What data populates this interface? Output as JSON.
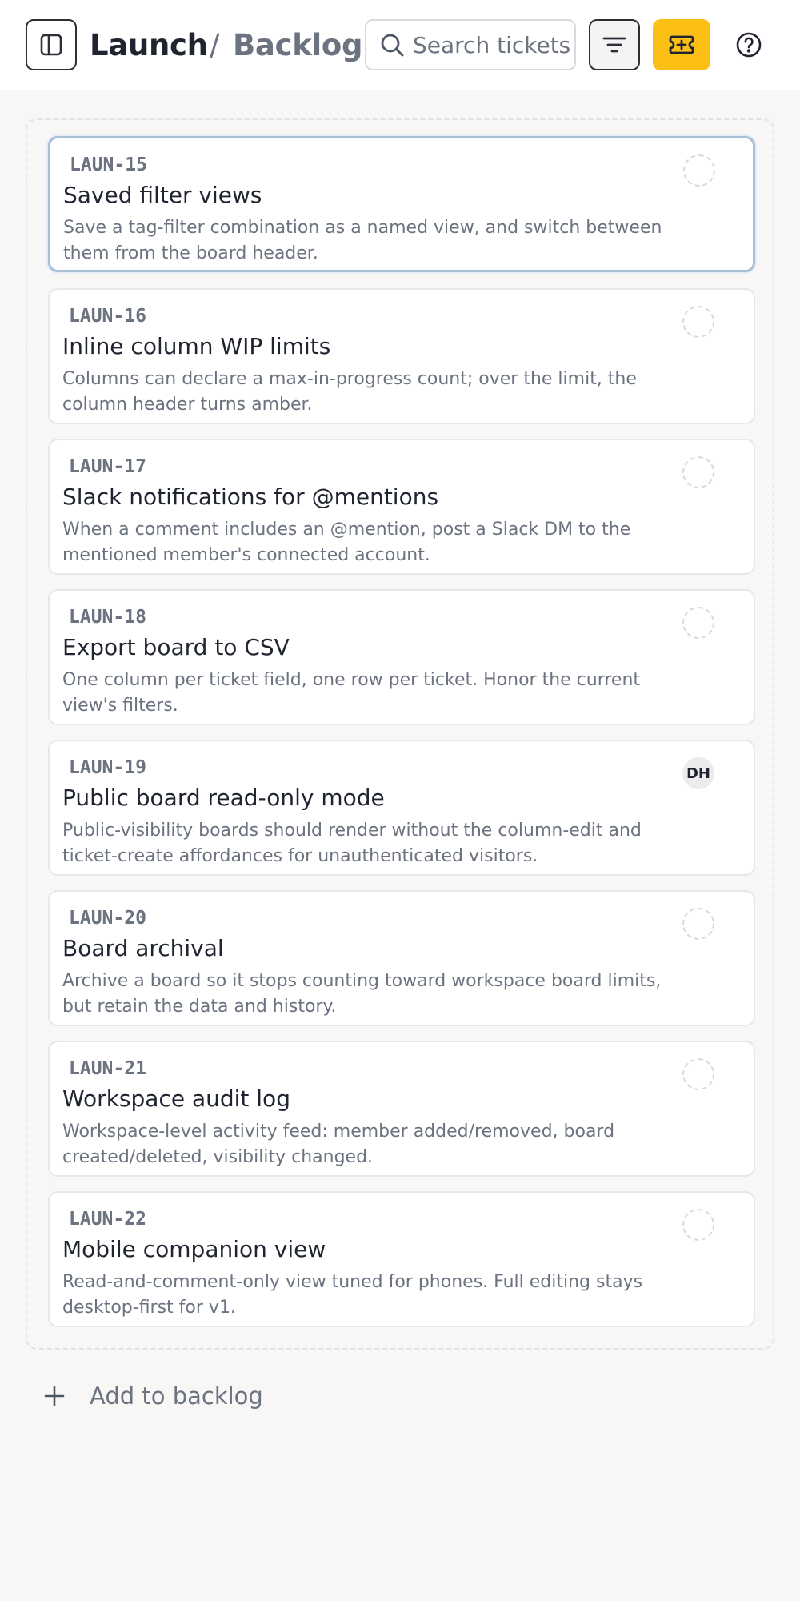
{
  "header": {
    "project": "Launch",
    "separator": "/",
    "page": "Backlog",
    "search_placeholder": "Search tickets"
  },
  "colors": {
    "accent": "#fbbf16",
    "selected_border": "#a9bfd8"
  },
  "icons": {
    "sidebar": "sidebar-toggle-icon",
    "search": "search-icon",
    "filter": "filter-icon",
    "ticket": "ticket-plus-icon",
    "help": "help-icon",
    "add": "plus-icon"
  },
  "cards": [
    {
      "id": "LAUN-15",
      "title": "Saved filter views",
      "desc": "Save a tag-filter combination as a named view, and switch between them from the board header.",
      "assignee": "",
      "selected": true
    },
    {
      "id": "LAUN-16",
      "title": "Inline column WIP limits",
      "desc": "Columns can declare a max-in-progress count; over the limit, the column header turns amber.",
      "assignee": ""
    },
    {
      "id": "LAUN-17",
      "title": "Slack notifications for @mentions",
      "desc": "When a comment includes an @mention, post a Slack DM to the mentioned member's connected account.",
      "assignee": ""
    },
    {
      "id": "LAUN-18",
      "title": "Export board to CSV",
      "desc": "One column per ticket field, one row per ticket. Honor the current view's filters.",
      "assignee": ""
    },
    {
      "id": "LAUN-19",
      "title": "Public board read-only mode",
      "desc": "Public-visibility boards should render without the column-edit and ticket-create affordances for unauthenticated visitors.",
      "assignee": "DH"
    },
    {
      "id": "LAUN-20",
      "title": "Board archival",
      "desc": "Archive a board so it stops counting toward workspace board limits, but retain the data and history.",
      "assignee": ""
    },
    {
      "id": "LAUN-21",
      "title": "Workspace audit log",
      "desc": "Workspace-level activity feed: member added/removed, board created/deleted, visibility changed.",
      "assignee": ""
    },
    {
      "id": "LAUN-22",
      "title": "Mobile companion view",
      "desc": "Read-and-comment-only view tuned for phones. Full editing stays desktop-first for v1.",
      "assignee": ""
    }
  ],
  "add_label": "Add to backlog"
}
